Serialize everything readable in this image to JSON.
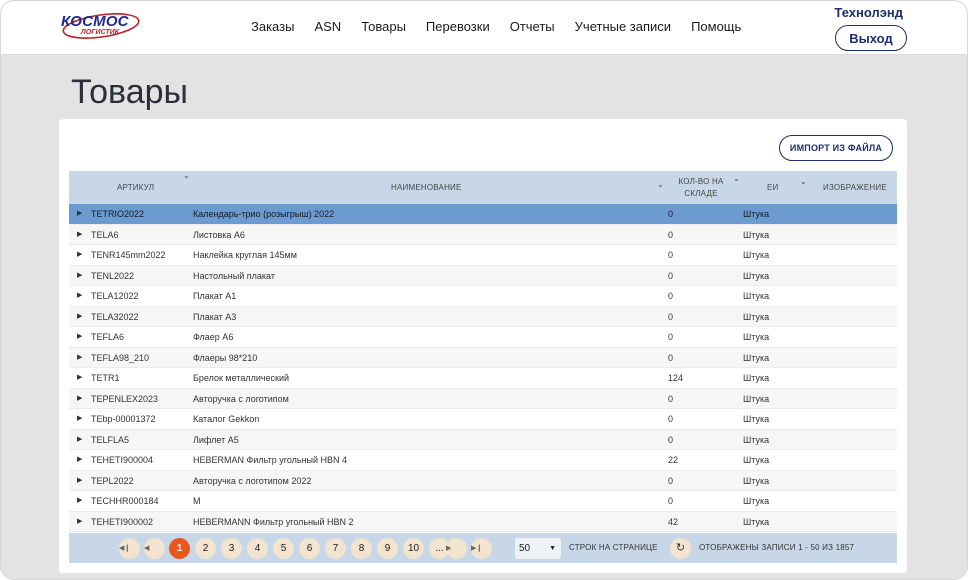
{
  "header": {
    "logo_brand": "КОСМОС",
    "logo_sub": "ЛОГИСТИК",
    "nav": [
      "Заказы",
      "ASN",
      "Товары",
      "Перевозки",
      "Отчеты",
      "Учетные записи",
      "Помощь"
    ],
    "user": "Технолэнд",
    "logout_label": "Выход"
  },
  "page_title": "Товары",
  "import_label": "ИМПОРТ ИЗ ФАЙЛА",
  "table": {
    "columns": {
      "article": "АРТИКУЛ",
      "name": "НАИМЕНОВАНИЕ",
      "qty": "КОЛ-ВО НА СКЛАДЕ",
      "unit": "ЕИ",
      "image": "ИЗОБРАЖЕНИЕ"
    },
    "rows": [
      {
        "article": "TETRIO2022",
        "name": "Календарь-трио (розыгрыш) 2022",
        "qty": "0",
        "unit": "Штука"
      },
      {
        "article": "TELA6",
        "name": "Листовка А6",
        "qty": "0",
        "unit": "Штука"
      },
      {
        "article": "TENR145mm2022",
        "name": "Наклейка круглая 145мм",
        "qty": "0",
        "unit": "Штука"
      },
      {
        "article": "TENL2022",
        "name": "Настольный плакат",
        "qty": "0",
        "unit": "Штука"
      },
      {
        "article": "TELA12022",
        "name": "Плакат А1",
        "qty": "0",
        "unit": "Штука"
      },
      {
        "article": "TELA32022",
        "name": "Плакат А3",
        "qty": "0",
        "unit": "Штука"
      },
      {
        "article": "TEFLA6",
        "name": "Флаер А6",
        "qty": "0",
        "unit": "Штука"
      },
      {
        "article": "TEFLA98_210",
        "name": "Флаеры 98*210",
        "qty": "0",
        "unit": "Штука"
      },
      {
        "article": "TETR1",
        "name": "Брелок металлический",
        "qty": "124",
        "unit": "Штука"
      },
      {
        "article": "TEPENLEX2023",
        "name": "Авторучка с логотипом",
        "qty": "0",
        "unit": "Штука"
      },
      {
        "article": "TEbp-00001372",
        "name": "Каталог Gekkon",
        "qty": "0",
        "unit": "Штука"
      },
      {
        "article": "TELFLA5",
        "name": "Лифлет А5",
        "qty": "0",
        "unit": "Штука"
      },
      {
        "article": "TEHETI900004",
        "name": "HEBERMAN Фильтр угольный HBN 4",
        "qty": "22",
        "unit": "Штука"
      },
      {
        "article": "TEPL2022",
        "name": "Авторучка с логотипом 2022",
        "qty": "0",
        "unit": "Штука"
      },
      {
        "article": "TECHHR000184",
        "name": "М",
        "qty": "0",
        "unit": "Штука"
      },
      {
        "article": "TEHETI900002",
        "name": "HEBERMANN Фильтр угольный HBN 2",
        "qty": "42",
        "unit": "Штука"
      }
    ]
  },
  "pager": {
    "pages": [
      "1",
      "2",
      "3",
      "4",
      "5",
      "6",
      "7",
      "8",
      "9",
      "10",
      "..."
    ],
    "current": "1",
    "page_size": "50",
    "page_size_label": "СТРОК НА СТРАНИЦЕ",
    "summary": "ОТОБРАЖЕНЫ ЗАПИСИ 1 - 50 ИЗ 1857"
  },
  "colors": {
    "brand_blue": "#1c2f6e",
    "header_row": "#c8d7e8",
    "selected_row": "#6b9bd1",
    "active_page": "#e8571d"
  }
}
